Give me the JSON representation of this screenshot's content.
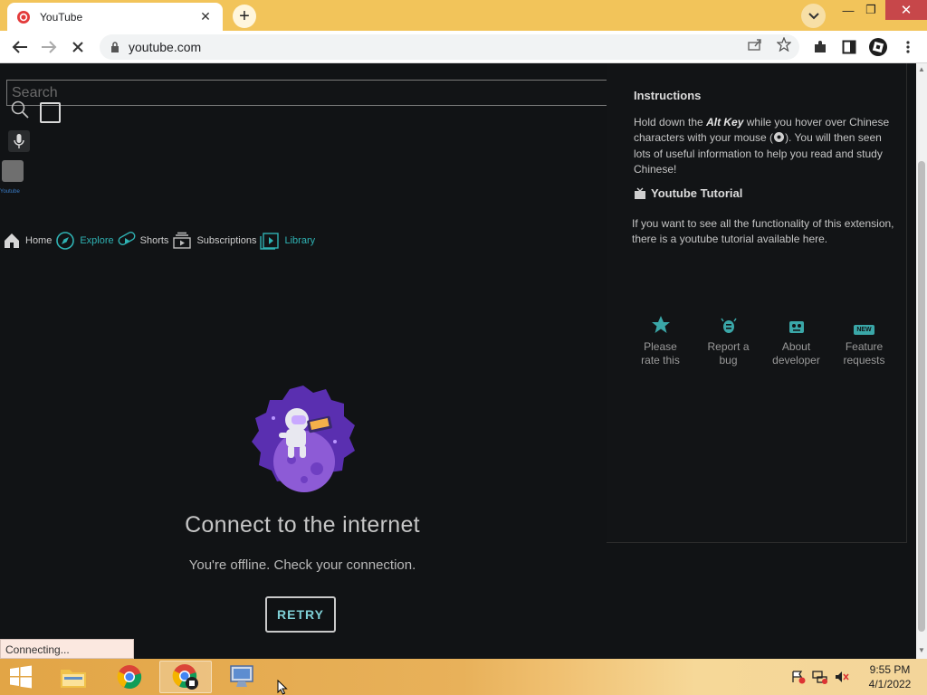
{
  "browser": {
    "tab_title": "YouTube",
    "url": "youtube.com",
    "colors": {
      "titlebar": "#f2c45a",
      "close": "#c7474a"
    }
  },
  "page": {
    "search_placeholder": "Search",
    "tiny_logo": "Youtube",
    "nav": [
      {
        "label": "Home",
        "icon": "home-icon",
        "teal": false
      },
      {
        "label": "Explore",
        "icon": "compass-icon",
        "teal": true
      },
      {
        "label": "Shorts",
        "icon": "shorts-icon",
        "teal": false
      },
      {
        "label": "Subscriptions",
        "icon": "subscriptions-icon",
        "teal": false
      },
      {
        "label": "Library",
        "icon": "library-icon",
        "teal": true
      }
    ],
    "offline": {
      "title": "Connect to the internet",
      "subtitle": "You're offline. Check your connection.",
      "retry_label": "RETRY"
    }
  },
  "extension": {
    "instructions_heading": "Instructions",
    "instructions_pre": "Hold down the ",
    "instructions_key": "Alt Key",
    "instructions_mid": " while you hover over Chinese characters with your mouse (",
    "instructions_post": "). You will then seen lots of useful information to help you read and study Chinese!",
    "tutorial_heading": "Youtube Tutorial",
    "tutorial_text": "If you want to see all the functionality of this extension, there is a youtube tutorial available here.",
    "actions": [
      {
        "line1": "Please",
        "line2": "rate this",
        "icon": "star-icon"
      },
      {
        "line1": "Report a",
        "line2": "bug",
        "icon": "bug-icon"
      },
      {
        "line1": "About",
        "line2": "developer",
        "icon": "developer-icon"
      },
      {
        "line1": "Feature",
        "line2": "requests",
        "icon": "new-badge-icon"
      }
    ],
    "new_badge": "NEW"
  },
  "status_text": "Connecting...",
  "taskbar": {
    "time": "9:55 PM",
    "date": "4/1/2022"
  }
}
